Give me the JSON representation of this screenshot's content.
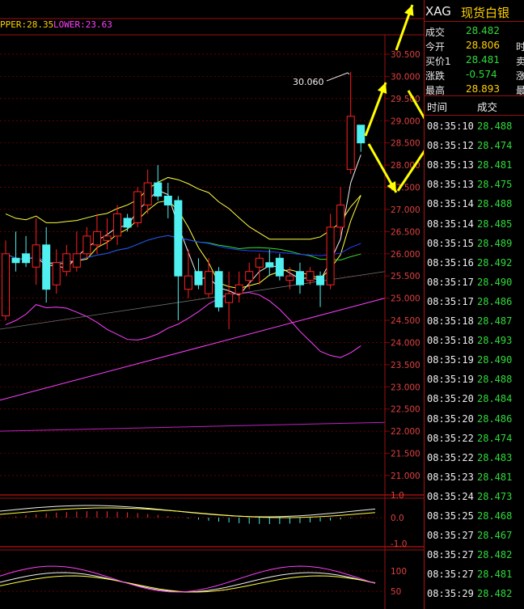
{
  "indicator_legend": {
    "upper": "PPER:28.35",
    "lower": "LOWER:23.63",
    "upper_color": "#ffd000",
    "lower_color": "#ff40ff"
  },
  "annotation": "30.060",
  "price_axis": [
    "30.500",
    "30.000",
    "29.500",
    "29.000",
    "28.500",
    "28.000",
    "27.500",
    "27.000",
    "26.500",
    "26.000",
    "25.500",
    "25.000",
    "24.500",
    "24.000",
    "23.500",
    "23.000",
    "22.500",
    "22.000",
    "21.500",
    "21.000"
  ],
  "macd_axis": [
    "1.0",
    "0.0",
    "-1.0"
  ],
  "kdj_axis": [
    "100",
    "50"
  ],
  "quote_header": {
    "symbol": "XAG",
    "name": "现货白银"
  },
  "quote_rows": [
    {
      "label": "成交",
      "value": "28.482",
      "cut": ""
    },
    {
      "label": "今开",
      "value": "28.806",
      "cut": "时"
    },
    {
      "label": "买价1",
      "value": "28.481",
      "cut": "卖"
    },
    {
      "label": "涨跌",
      "value": "-0.574",
      "cut": "涨"
    },
    {
      "label": "最高",
      "value": "28.893",
      "cut": "最"
    }
  ],
  "ticks_header": {
    "time": "时间",
    "price": "成交"
  },
  "ticks": [
    {
      "time": "08:35:10",
      "price": "28.488"
    },
    {
      "time": "08:35:12",
      "price": "28.474"
    },
    {
      "time": "08:35:13",
      "price": "28.481"
    },
    {
      "time": "08:35:13",
      "price": "28.475"
    },
    {
      "time": "08:35:14",
      "price": "28.488"
    },
    {
      "time": "08:35:14",
      "price": "28.485"
    },
    {
      "time": "08:35:15",
      "price": "28.489"
    },
    {
      "time": "08:35:16",
      "price": "28.492"
    },
    {
      "time": "08:35:17",
      "price": "28.490"
    },
    {
      "time": "08:35:17",
      "price": "28.486"
    },
    {
      "time": "08:35:18",
      "price": "28.487"
    },
    {
      "time": "08:35:18",
      "price": "28.493"
    },
    {
      "time": "08:35:19",
      "price": "28.490"
    },
    {
      "time": "08:35:19",
      "price": "28.488"
    },
    {
      "time": "08:35:20",
      "price": "28.484"
    },
    {
      "time": "08:35:20",
      "price": "28.486"
    },
    {
      "time": "08:35:22",
      "price": "28.474"
    },
    {
      "time": "08:35:22",
      "price": "28.483"
    },
    {
      "time": "08:35:23",
      "price": "28.481"
    },
    {
      "time": "08:35:24",
      "price": "28.473"
    },
    {
      "time": "08:35:25",
      "price": "28.468"
    },
    {
      "time": "08:35:27",
      "price": "28.467"
    },
    {
      "time": "08:35:27",
      "price": "28.482"
    },
    {
      "time": "08:35:27",
      "price": "28.481"
    },
    {
      "time": "08:35:29",
      "price": "28.482"
    }
  ],
  "candles": [
    {
      "o": 24.6,
      "h": 26.3,
      "l": 24.5,
      "c": 26.0
    },
    {
      "o": 25.9,
      "h": 26.5,
      "l": 25.6,
      "c": 25.8
    },
    {
      "o": 26.0,
      "h": 26.4,
      "l": 25.7,
      "c": 25.8
    },
    {
      "o": 25.7,
      "h": 26.8,
      "l": 25.3,
      "c": 26.2
    },
    {
      "o": 26.2,
      "h": 26.6,
      "l": 24.9,
      "c": 25.2
    },
    {
      "o": 25.3,
      "h": 26.1,
      "l": 25.1,
      "c": 25.8
    },
    {
      "o": 25.6,
      "h": 26.2,
      "l": 25.5,
      "c": 26.0
    },
    {
      "o": 25.7,
      "h": 26.5,
      "l": 25.6,
      "c": 26.0
    },
    {
      "o": 26.0,
      "h": 26.6,
      "l": 25.9,
      "c": 26.4
    },
    {
      "o": 26.2,
      "h": 26.9,
      "l": 26.0,
      "c": 26.5
    },
    {
      "o": 26.3,
      "h": 26.8,
      "l": 26.1,
      "c": 26.4
    },
    {
      "o": 26.4,
      "h": 27.1,
      "l": 26.2,
      "c": 26.9
    },
    {
      "o": 26.8,
      "h": 26.9,
      "l": 26.5,
      "c": 26.6
    },
    {
      "o": 26.7,
      "h": 27.5,
      "l": 26.6,
      "c": 27.4
    },
    {
      "o": 27.1,
      "h": 27.9,
      "l": 26.9,
      "c": 27.6
    },
    {
      "o": 27.6,
      "h": 28.0,
      "l": 27.2,
      "c": 27.3
    },
    {
      "o": 27.3,
      "h": 27.6,
      "l": 26.8,
      "c": 27.1
    },
    {
      "o": 27.2,
      "h": 27.3,
      "l": 24.5,
      "c": 25.5
    },
    {
      "o": 25.2,
      "h": 26.1,
      "l": 25.0,
      "c": 25.5
    },
    {
      "o": 25.6,
      "h": 25.9,
      "l": 25.2,
      "c": 25.3
    },
    {
      "o": 25.1,
      "h": 25.9,
      "l": 25.0,
      "c": 25.6
    },
    {
      "o": 25.6,
      "h": 25.7,
      "l": 24.7,
      "c": 24.8
    },
    {
      "o": 24.9,
      "h": 25.6,
      "l": 24.3,
      "c": 25.1
    },
    {
      "o": 25.1,
      "h": 25.6,
      "l": 24.9,
      "c": 25.3
    },
    {
      "o": 25.4,
      "h": 25.8,
      "l": 25.2,
      "c": 25.6
    },
    {
      "o": 25.7,
      "h": 26.0,
      "l": 25.3,
      "c": 25.9
    },
    {
      "o": 25.8,
      "h": 26.1,
      "l": 25.5,
      "c": 25.7
    },
    {
      "o": 25.9,
      "h": 26.0,
      "l": 25.4,
      "c": 25.5
    },
    {
      "o": 25.4,
      "h": 25.7,
      "l": 25.2,
      "c": 25.5
    },
    {
      "o": 25.6,
      "h": 25.8,
      "l": 25.1,
      "c": 25.3
    },
    {
      "o": 25.4,
      "h": 25.7,
      "l": 25.3,
      "c": 25.6
    },
    {
      "o": 25.5,
      "h": 25.6,
      "l": 24.8,
      "c": 25.3
    },
    {
      "o": 25.3,
      "h": 26.9,
      "l": 25.2,
      "c": 26.6
    },
    {
      "o": 26.6,
      "h": 27.5,
      "l": 26.4,
      "c": 27.1
    },
    {
      "o": 27.9,
      "h": 30.1,
      "l": 27.8,
      "c": 29.1
    },
    {
      "o": 28.9,
      "h": 28.9,
      "l": 28.3,
      "c": 28.5
    }
  ],
  "colors": {
    "up": "#ff2020",
    "down": "#50f0f0",
    "grid": "#8a0000",
    "axis_text": "#e04040",
    "arrow": "#ffff00"
  }
}
